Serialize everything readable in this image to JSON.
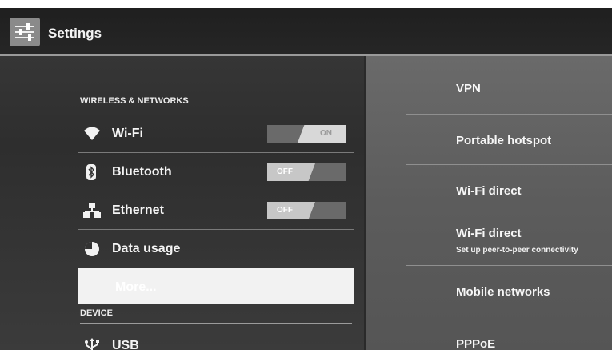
{
  "header": {
    "title": "Settings",
    "icon": "settings-sliders-icon"
  },
  "left": {
    "sections": [
      {
        "header": "WIRELESS & NETWORKS"
      },
      {
        "header": "DEVICE"
      }
    ],
    "items": [
      {
        "label": "Wi-Fi",
        "icon": "wifi-icon",
        "toggle": "ON"
      },
      {
        "label": "Bluetooth",
        "icon": "bluetooth-icon",
        "toggle": "OFF"
      },
      {
        "label": "Ethernet",
        "icon": "ethernet-icon",
        "toggle": "OFF"
      },
      {
        "label": "Data usage",
        "icon": "data-usage-icon"
      },
      {
        "label": "More...",
        "selected": true
      },
      {
        "label": "USB",
        "icon": "usb-icon"
      }
    ]
  },
  "right": {
    "items": [
      {
        "title": "VPN"
      },
      {
        "title": "Portable hotspot"
      },
      {
        "title": "Wi-Fi direct"
      },
      {
        "title": "Wi-Fi direct",
        "subtitle": "Set up peer-to-peer connectivity"
      },
      {
        "title": "Mobile networks"
      },
      {
        "title": "PPPoE"
      }
    ]
  },
  "colors": {
    "background": "#333333",
    "detail_pane": "#5e5e5e",
    "selected_row": "#f2f2f2",
    "toggle_knob": "#d8d8d8"
  }
}
